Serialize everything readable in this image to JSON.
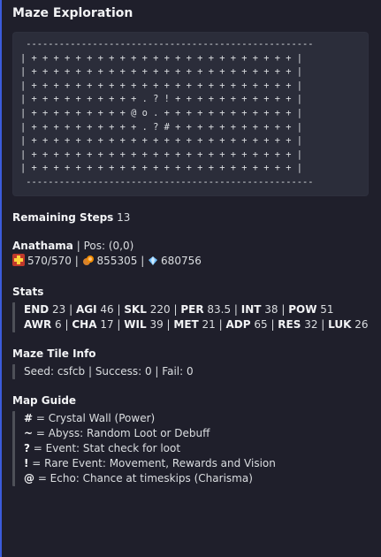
{
  "embed": {
    "title": "Maze Exploration",
    "accent_color": "#3b5bdb",
    "maze_lines": [
      " ----------------------------------------------------",
      "| + + + + + + + + + + + + + + + + + + + + + + + + |",
      "| + + + + + + + + + + + + + + + + + + + + + + + + |",
      "| + + + + + + + + + + + + + + + + + + + + + + + + |",
      "| + + + + + + + + + + . ? ! + + + + + + + + + + + |",
      "| + + + + + + + + + @ o . + + + + + + + + + + + + |",
      "| + + + + + + + + + + . ? # + + + + + + + + + + + |",
      "| + + + + + + + + + + + + + + + + + + + + + + + + |",
      "| + + + + + + + + + + + + + + + + + + + + + + + + |",
      "| + + + + + + + + + + + + + + + + + + + + + + + + |",
      " ----------------------------------------------------"
    ],
    "remaining_steps": {
      "label": "Remaining Steps",
      "value": "13"
    },
    "player": {
      "name": "Anathama",
      "pos": " | Pos: (0,0)",
      "hp": "570/570",
      "gold": "855305",
      "gems": "680756",
      "icons": [
        "health-cross-icon",
        "gold-pile-icon",
        "crystal-gem-icon"
      ]
    },
    "stats": {
      "title": "Stats",
      "line1": [
        {
          "k": "END",
          "v": "23"
        },
        {
          "k": "AGI",
          "v": "46"
        },
        {
          "k": "SKL",
          "v": "220"
        },
        {
          "k": "PER",
          "v": "83.5"
        },
        {
          "k": "INT",
          "v": "38"
        },
        {
          "k": "POW",
          "v": "51"
        }
      ],
      "line2": [
        {
          "k": "AWR",
          "v": "6"
        },
        {
          "k": "CHA",
          "v": "17"
        },
        {
          "k": "WIL",
          "v": "39"
        },
        {
          "k": "MET",
          "v": "21"
        },
        {
          "k": "ADP",
          "v": "65"
        },
        {
          "k": "RES",
          "v": "32"
        },
        {
          "k": "LUK",
          "v": "26"
        }
      ]
    },
    "tile_info": {
      "title": "Maze Tile Info",
      "text": "Seed: csfcb | Success: 0 | Fail: 0"
    },
    "map_guide": {
      "title": "Map Guide",
      "entries": [
        {
          "sym": "#",
          "desc": " = Crystal Wall (Power)"
        },
        {
          "sym": "~",
          "desc": " = Abyss: Random Loot or Debuff"
        },
        {
          "sym": "?",
          "desc": " = Event: Stat check for loot"
        },
        {
          "sym": "!",
          "desc": " = Rare Event: Movement, Rewards and Vision"
        },
        {
          "sym": "@",
          "desc": " = Echo: Chance at timeskips (Charisma)"
        }
      ]
    }
  }
}
